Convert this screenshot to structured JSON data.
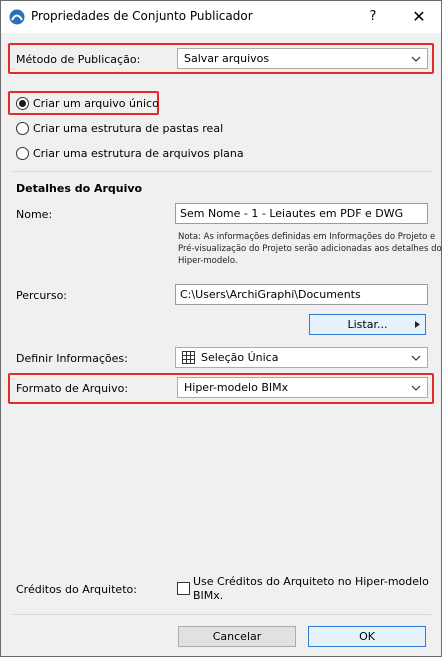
{
  "window": {
    "title": "Propriedades de Conjunto Publicador",
    "help_label": "?",
    "close_label": "✕"
  },
  "publish_method": {
    "label": "Método de Publicação:",
    "value": "Salvar arquivos"
  },
  "structure_options": [
    {
      "label": "Criar um arquivo único",
      "selected": true
    },
    {
      "label": "Criar uma estrutura de pastas real",
      "selected": false
    },
    {
      "label": "Criar uma estrutura de arquivos plana",
      "selected": false
    }
  ],
  "file_details": {
    "heading": "Detalhes do Arquivo",
    "name_label": "Nome:",
    "name_value": "Sem Nome - 1 - Leiautes em PDF e DWG",
    "note_lines": [
      "Nota: As informações definidas em Informações do Projeto e",
      "Pré-visualização do Projeto serão adicionadas aos detalhes do",
      "Hiper-modelo."
    ],
    "path_label": "Percurso:",
    "path_value": "C:\\Users\\ArchiGraphi\\Documents",
    "list_button": "Listar...",
    "info_label": "Definir Informações:",
    "info_value": "Seleção Única",
    "format_label": "Formato de Arquivo:",
    "format_value": "Hiper-modelo BIMx"
  },
  "architect_credits": {
    "label": "Créditos do Arquiteto:",
    "checkbox_line1": "Use Créditos do Arquiteto no Hiper-modelo",
    "checkbox_line2": "BIMx.",
    "checked": false
  },
  "footer": {
    "cancel_label": "Cancelar",
    "ok_label": "OK"
  },
  "colors": {
    "highlight": "#e52a2a",
    "accent": "#2f7bd8",
    "dialog_bg": "#f0f0f0"
  }
}
